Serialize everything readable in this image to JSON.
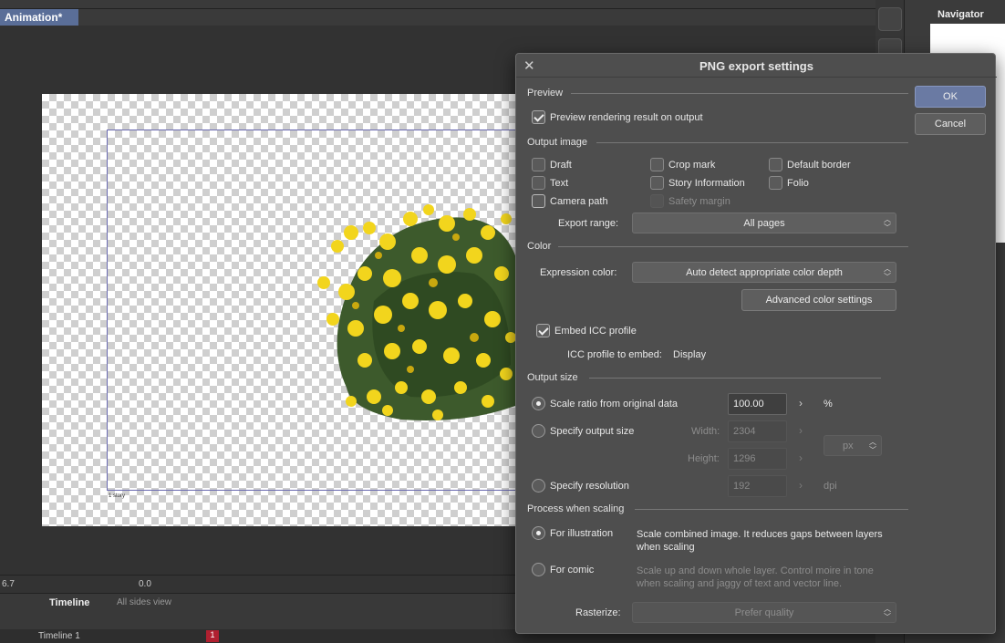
{
  "document": {
    "tab_label": "Animation*"
  },
  "canvas": {
    "frame_label": "1 story"
  },
  "navigator": {
    "title": "Navigator"
  },
  "status": {
    "zoom": "6.7",
    "rotation": "0.0"
  },
  "timeline": {
    "tab_label": "Timeline",
    "all_sides_label": "All sides view",
    "row_label": "Timeline 1",
    "frame_marker": "1"
  },
  "dialog": {
    "title": "PNG export settings",
    "ok_label": "OK",
    "cancel_label": "Cancel",
    "preview": {
      "section": "Preview",
      "rendering_label": "Preview rendering result on output",
      "rendering_checked": true
    },
    "output_image": {
      "section": "Output image",
      "draft": "Draft",
      "crop_mark": "Crop mark",
      "default_border": "Default border",
      "text": "Text",
      "story_information": "Story Information",
      "folio": "Folio",
      "camera_path": "Camera path",
      "safety_margin": "Safety margin",
      "export_range_label": "Export range:",
      "export_range_value": "All pages"
    },
    "color": {
      "section": "Color",
      "expression_label": "Expression color:",
      "expression_value": "Auto detect appropriate color depth",
      "advanced_button": "Advanced color settings",
      "embed_icc_label": "Embed ICC profile",
      "embed_icc_checked": true,
      "icc_profile_label": "ICC profile to embed:",
      "icc_profile_value": "Display"
    },
    "output_size": {
      "section": "Output size",
      "scale_ratio_label": "Scale ratio from original data",
      "scale_ratio_value": "100.00",
      "scale_ratio_unit": "%",
      "specify_size_label": "Specify output size",
      "width_label": "Width:",
      "width_value": "2304",
      "height_label": "Height:",
      "height_value": "1296",
      "size_unit": "px",
      "specify_resolution_label": "Specify resolution",
      "resolution_value": "192",
      "resolution_unit": "dpi",
      "selected": "scale_ratio"
    },
    "scaling": {
      "section": "Process when scaling",
      "illustration_label": "For illustration",
      "illustration_desc": "Scale combined image. It reduces gaps between layers when scaling",
      "comic_label": "For comic",
      "comic_desc": "Scale up and down whole layer. Control moire in tone when scaling and jaggy of text and vector line.",
      "rasterize_label": "Rasterize:",
      "rasterize_value": "Prefer quality",
      "selected": "illustration"
    }
  }
}
